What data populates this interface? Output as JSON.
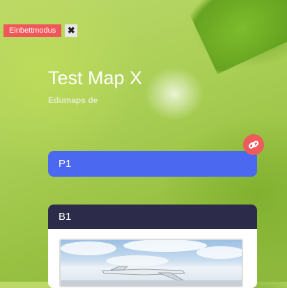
{
  "embed": {
    "badge_label": "Einbettmodus",
    "close_glyph": "✖"
  },
  "map": {
    "title": "Test Map X",
    "subtitle": "Edumaps de"
  },
  "cards": [
    {
      "label": "P1",
      "color": "#4a68f0"
    },
    {
      "label": "B1",
      "header_color": "#2c2b49"
    }
  ],
  "icons": {
    "link": "link-icon",
    "accent": "#ef5a5d"
  }
}
